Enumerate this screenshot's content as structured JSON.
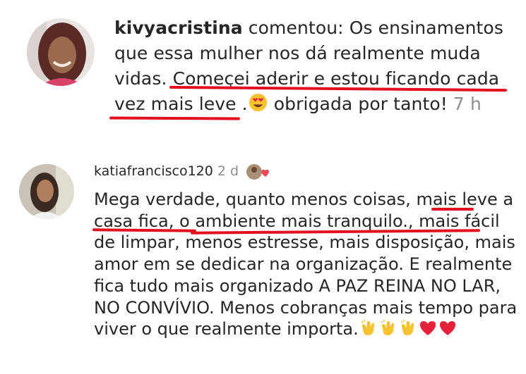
{
  "comment1": {
    "username": "kivyacristina",
    "verb": "comentou:",
    "text_part1": "Os ensinamentos que essa mulher nos dá realmente muda vidas. ",
    "text_highlight": "Começei aderir e estou ficando cada vez mais leve",
    "text_part2": " .",
    "emoji": "heart-eyes-emoji",
    "text_part3": " obrigada por tanto! ",
    "timestamp": "7 h",
    "highlight_color": "#e3101f"
  },
  "comment2": {
    "username": "katiafrancisco120",
    "timestamp": "2 d",
    "liked_by_author_icon": "author-heart-icon",
    "text_part1": "Mega verdade, quanto menos coisas, ",
    "text_highlight": "mais leve a casa fica, o ambiente mais tranquilo",
    "text_part2": "., mais fácil de limpar, menos estresse, mais disposição, mais amor em se dedicar na organização.  E realmente fica tudo mais organizado A PAZ REINA NO LAR, NO CONVÍVIO. Menos cobranças mais tempo para viver o que realmente importa.",
    "emojis": [
      "clapping-hands-emoji",
      "clapping-hands-emoji",
      "clapping-hands-emoji",
      "red-heart-emoji",
      "red-heart-emoji"
    ]
  },
  "colors": {
    "text": "#262626",
    "muted": "#8e8e8e",
    "underline": "#e3101f"
  }
}
